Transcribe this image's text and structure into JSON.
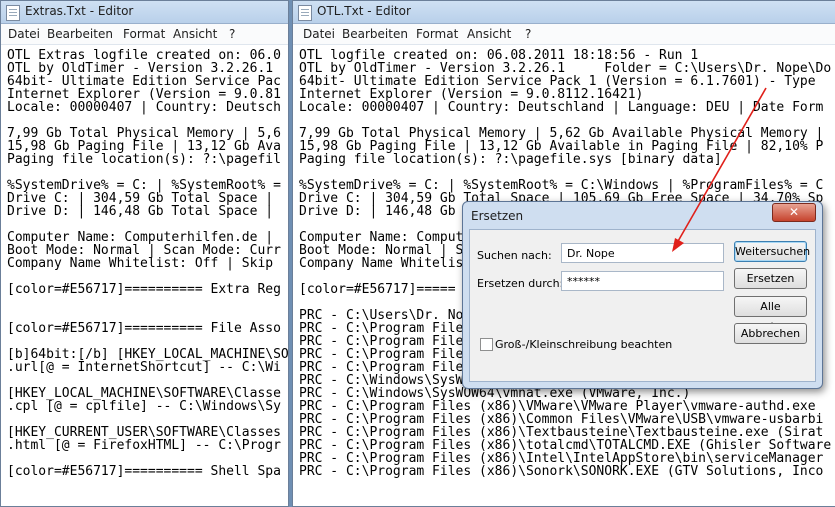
{
  "left_window": {
    "title": "Extras.Txt - Editor",
    "menu": [
      "Datei",
      "Bearbeiten",
      "Format",
      "Ansicht",
      "?"
    ],
    "lines": [
      "OTL Extras logfile created on: 06.0",
      "OTL by OldTimer - Version 3.2.26.1",
      "64bit- Ultimate Edition Service Pac",
      "Internet Explorer (Version = 9.0.81",
      "Locale: 00000407 | Country: Deutsch",
      "",
      "7,99 Gb Total Physical Memory | 5,6",
      "15,98 Gb Paging File | 13,12 Gb Ava",
      "Paging file location(s): ?:\\pagefil",
      "",
      "%SystemDrive% = C: | %SystemRoot% =",
      "Drive C: | 304,59 Gb Total Space |",
      "Drive D: | 146,48 Gb Total Space |",
      "",
      "Computer Name: Computerhilfen.de |",
      "Boot Mode: Normal | Scan Mode: Curr",
      "Company Name Whitelist: Off | Skip",
      "",
      "[color=#E56717]========== Extra Reg",
      "",
      "",
      "[color=#E56717]========== File Asso",
      "",
      "[b]64bit:[/b] [HKEY_LOCAL_MACHINE\\SO",
      ".url[@ = InternetShortcut] -- C:\\Wi",
      "",
      "[HKEY_LOCAL_MACHINE\\SOFTWARE\\Classe",
      ".cpl [@ = cplfile] -- C:\\Windows\\Sy",
      "",
      "[HKEY_CURRENT_USER\\SOFTWARE\\Classes",
      ".html [@ = FirefoxHTML] -- C:\\Progr",
      "",
      "[color=#E56717]========== Shell Spa"
    ]
  },
  "right_window": {
    "title": "OTL.Txt - Editor",
    "menu": [
      "Datei",
      "Bearbeiten",
      "Format",
      "Ansicht",
      "?"
    ],
    "lines": [
      "OTL logfile created on: 06.08.2011 18:18:56 - Run 1",
      "OTL by OldTimer - Version 3.2.26.1     Folder = C:\\Users\\Dr. Nope\\Do",
      "64bit- Ultimate Edition Service Pack 1 (Version = 6.1.7601) - Type",
      "Internet Explorer (Version = 9.0.8112.16421)",
      "Locale: 00000407 | Country: Deutschland | Language: DEU | Date Form",
      "",
      "7,99 Gb Total Physical Memory | 5,62 Gb Available Physical Memory |",
      "15,98 Gb Paging File | 13,12 Gb Available in Paging File | 82,10% P",
      "Paging file location(s): ?:\\pagefile.sys [binary data]",
      "",
      "%SystemDrive% = C: | %SystemRoot% = C:\\Windows | %ProgramFiles% = C",
      "Drive C: | 304,59 Gb Total Space | 105,69 Gb Free Space | 34,70% Sp",
      "Drive D: | 146,48 Gb Total Space | 118,37 Gb Free Space | 80,81% Sp",
      "",
      "Computer Name: Comput",
      "Boot Mode: Normal | S",
      "Company Name Whitelis",
      "",
      "[color=#E56717]=====",
      "",
      "PRC - C:\\Users\\Dr. No",
      "PRC - C:\\Program File",
      "PRC - C:\\Program File",
      "PRC - C:\\Program File",
      "PRC - C:\\Program File",
      "PRC - C:\\Windows\\SysWOW64\\vmnetdhcp.exe (VMware, Inc.)",
      "PRC - C:\\Windows\\SysWOW64\\vmnat.exe (VMware, Inc.)",
      "PRC - C:\\Program Files (x86)\\VMware\\VMware Player\\vmware-authd.exe",
      "PRC - C:\\Program Files (x86)\\Common Files\\VMware\\USB\\vmware-usbarbi",
      "PRC - C:\\Program Files (x86)\\Textbausteine\\Textbausteine.exe (Sirat",
      "PRC - C:\\Program Files (x86)\\totalcmd\\TOTALCMD.EXE (Ghisler Software",
      "PRC - C:\\Program Files (x86)\\Intel\\IntelAppStore\\bin\\serviceManager",
      "PRC - C:\\Program Files (x86)\\Sonork\\SONORK.EXE (GTV Solutions, Inco"
    ]
  },
  "dialog": {
    "title": "Ersetzen",
    "close_label": "✕",
    "find_label": "Suchen nach:",
    "find_value": "Dr. Nope",
    "replace_label": "Ersetzen durch:",
    "replace_value": "******",
    "match_case_label": "Groß-/Kleinschreibung beachten",
    "match_case_checked": false,
    "buttons": {
      "find_next": "Weitersuchen",
      "replace": "Ersetzen",
      "replace_all": "Alle ersetzen",
      "cancel": "Abbrechen"
    }
  },
  "annotation": {
    "arrow_color": "#e0201a"
  }
}
